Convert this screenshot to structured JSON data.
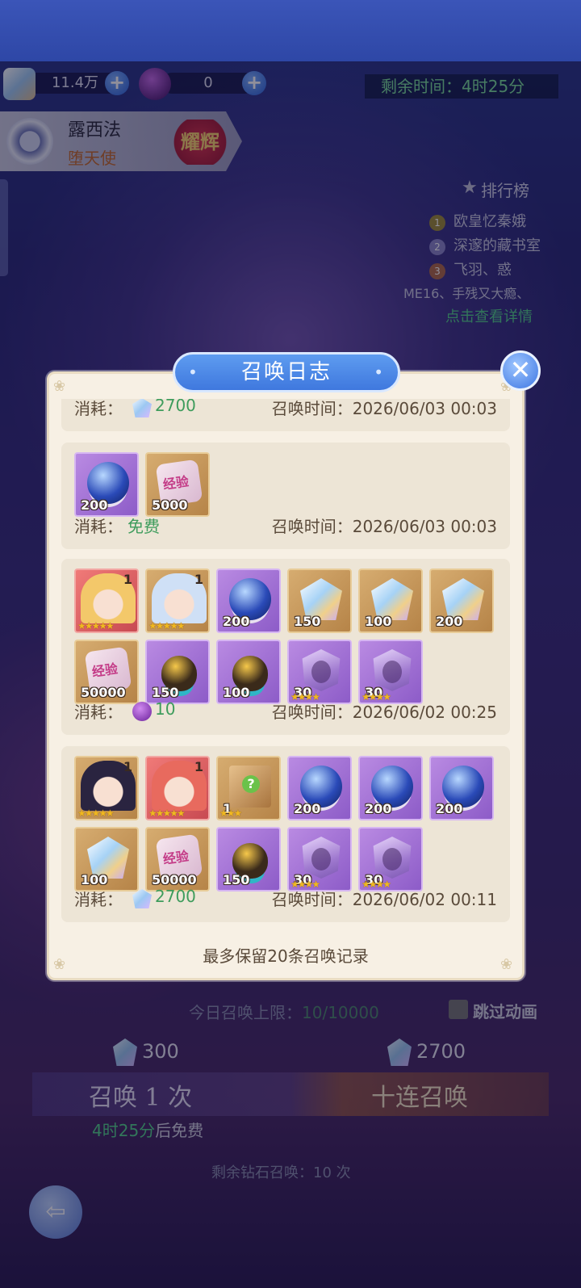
{
  "resources": {
    "crystal_amount": "11.4万",
    "orb_amount": "0"
  },
  "timer_text": "剩余时间：4时25分",
  "character": {
    "name": "露西法",
    "title": "堕天使",
    "badge": "耀辉"
  },
  "ranking": {
    "title": "排行榜",
    "items": [
      {
        "rank": "1",
        "name": "欧皇忆秦娥"
      },
      {
        "rank": "2",
        "name": "深邃的藏书室"
      },
      {
        "rank": "3",
        "name": "飞羽、惑"
      }
    ],
    "partial_item": "ME16、手残又大瘾、",
    "detail_link": "点击查看详情"
  },
  "dialog": {
    "title": "召唤日志",
    "footnote": "最多保留20条召唤记录",
    "cost_label": "消耗：",
    "time_label": "召唤时间：",
    "records": [
      {
        "cost": "2700",
        "cost_icon": "crystal-icon",
        "time": "2026/06/03 00:03",
        "rows": []
      },
      {
        "cost": "免费",
        "cost_icon": "",
        "time": "2026/06/03 00:03",
        "rows": [
          [
            {
              "type": "orb",
              "frame": "purple",
              "qty": "200"
            },
            {
              "type": "heart",
              "frame": "gold",
              "qty": "5000"
            }
          ]
        ]
      },
      {
        "cost": "10",
        "cost_icon": "orb-icon",
        "time": "2026/06/02 00:25",
        "rows": [
          [
            {
              "type": "portrait",
              "frame": "red",
              "corner": "1",
              "stars": "★★★★★",
              "hair": "#f3c86a"
            },
            {
              "type": "portrait",
              "frame": "gold",
              "corner": "1",
              "stars": "★★★★★",
              "hair": "#cfe0f6"
            },
            {
              "type": "orb",
              "frame": "purple",
              "qty": "200"
            },
            {
              "type": "crystal",
              "frame": "gold",
              "qty": "150"
            },
            {
              "type": "crystal",
              "frame": "gold",
              "qty": "100"
            },
            {
              "type": "crystal",
              "frame": "gold",
              "qty": "200"
            }
          ],
          [
            {
              "type": "heart",
              "frame": "gold",
              "qty": "50000"
            },
            {
              "type": "egg",
              "frame": "purple",
              "qty": "150"
            },
            {
              "type": "egg",
              "frame": "purple",
              "qty": "100"
            },
            {
              "type": "shard",
              "frame": "purple",
              "qty": "30",
              "stars": "★★★★"
            },
            {
              "type": "shard",
              "frame": "purple",
              "qty": "30",
              "stars": "★★★★"
            }
          ]
        ]
      },
      {
        "cost": "2700",
        "cost_icon": "crystal-icon",
        "time": "2026/06/02 00:11",
        "rows": [
          [
            {
              "type": "portrait",
              "frame": "gold",
              "corner": "1",
              "stars": "★★★★★",
              "hair": "#2a2440"
            },
            {
              "type": "portrait",
              "frame": "red",
              "corner": "1",
              "stars": "★★★★★",
              "hair": "#e86a5e"
            },
            {
              "type": "chest",
              "frame": "gold",
              "qty": "1",
              "stars": "★★★"
            },
            {
              "type": "orb",
              "frame": "purple",
              "qty": "200"
            },
            {
              "type": "orb",
              "frame": "purple",
              "qty": "200"
            },
            {
              "type": "orb",
              "frame": "purple",
              "qty": "200"
            }
          ],
          [
            {
              "type": "crystal",
              "frame": "gold",
              "qty": "100"
            },
            {
              "type": "heart",
              "frame": "gold",
              "qty": "50000"
            },
            {
              "type": "egg",
              "frame": "purple",
              "qty": "150"
            },
            {
              "type": "shard",
              "frame": "purple",
              "qty": "30",
              "stars": "★★★★"
            },
            {
              "type": "shard",
              "frame": "purple",
              "qty": "30",
              "stars": "★★★★"
            }
          ]
        ]
      }
    ]
  },
  "bottom": {
    "limit_label": "今日召唤上限：",
    "limit_value": "10/10000",
    "skip_label": "跳过动画",
    "single_cost": "300",
    "ten_cost": "2700",
    "single_label": "召唤 1 次",
    "ten_label": "十连召唤",
    "free_time": "4时25分",
    "free_suffix": "后免费",
    "remaining_label": "剩余钻石召唤：",
    "remaining_value": "10 次"
  },
  "colors": {
    "accent_blue": "#3f78de",
    "dialog_bg": "#f7f0e4",
    "free_green": "#3e9c5c"
  }
}
